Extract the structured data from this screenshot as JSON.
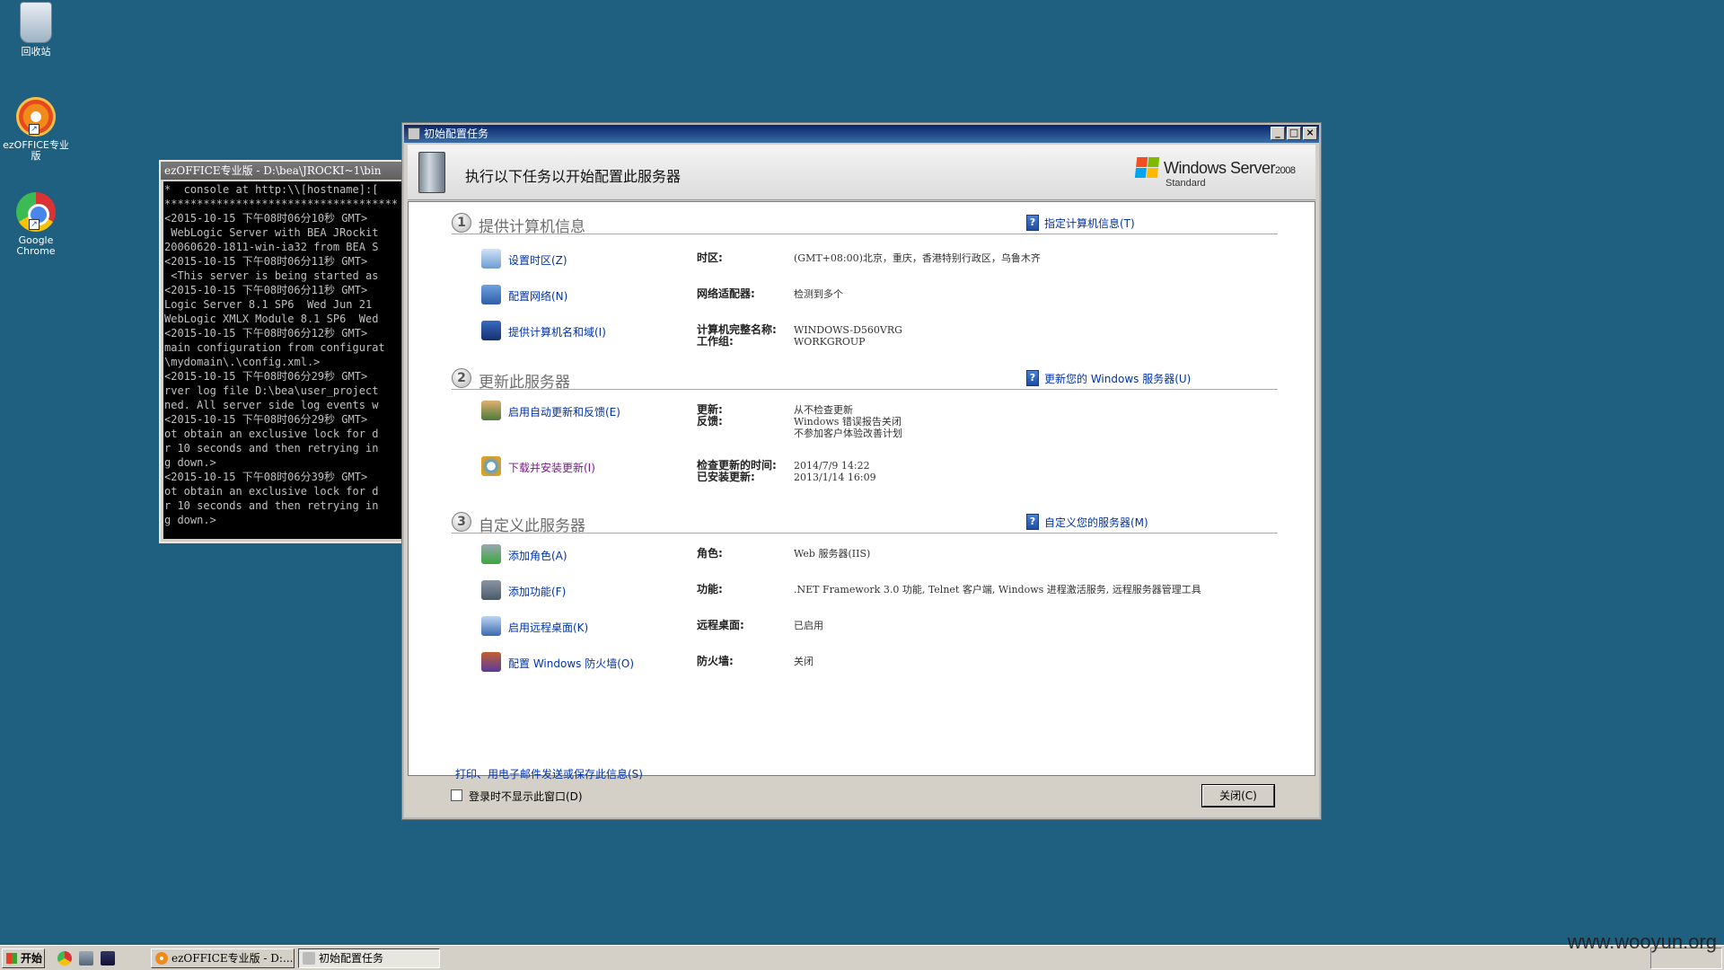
{
  "desktop": {
    "icons": [
      {
        "label": "回收站",
        "icon": "recycle-bin-icon"
      },
      {
        "label": "ezOFFICE专业版",
        "icon": "ezoffice-icon"
      },
      {
        "label": "Google Chrome",
        "icon": "chrome-icon"
      }
    ]
  },
  "console": {
    "title": "ezOFFICE专业版 - D:\\bea\\JROCKI~1\\bin",
    "lines": [
      "*  console at http:\\\\[hostname]:[",
      "************************************",
      "<2015-10-15 下午08时06分10秒 GMT>",
      " WebLogic Server with BEA JRockit",
      "20060620-1811-win-ia32 from BEA S",
      "<2015-10-15 下午08时06分11秒 GMT>",
      " <This server is being started as",
      "<2015-10-15 下午08时06分11秒 GMT>",
      "Logic Server 8.1 SP6  Wed Jun 21 ",
      "WebLogic XMLX Module 8.1 SP6  Wed",
      "<2015-10-15 下午08时06分12秒 GMT>",
      "main configuration from configurat",
      "\\mydomain\\.\\config.xml.>",
      "<2015-10-15 下午08时06分29秒 GMT>",
      "rver log file D:\\bea\\user_project",
      "ned. All server side log events w",
      "<2015-10-15 下午08时06分29秒 GMT>",
      "ot obtain an exclusive lock for d",
      "r 10 seconds and then retrying in",
      "g down.>",
      "<2015-10-15 下午08时06分39秒 GMT>",
      "ot obtain an exclusive lock for d",
      "r 10 seconds and then retrying in",
      "g down.>"
    ]
  },
  "dialog": {
    "title": "初始配置任务",
    "header_text": "执行以下任务以开始配置此服务器",
    "brand": {
      "name": "Windows Server",
      "version": "2008",
      "edition": "Standard"
    },
    "window_buttons": {
      "minimize": "_",
      "maximize": "□",
      "close": "×"
    },
    "sections": [
      {
        "num": "1",
        "title": "提供计算机信息",
        "link": "指定计算机信息(T)",
        "tasks": [
          {
            "link": "设置时区(Z)",
            "icon": "clock-icon",
            "rows": [
              {
                "label": "时区:",
                "values": [
                  "(GMT+08:00)北京，重庆，香港特别行政区，乌鲁木齐"
                ]
              }
            ]
          },
          {
            "link": "配置网络(N)",
            "icon": "network-icon",
            "rows": [
              {
                "label": "网络适配器:",
                "values": [
                  "检测到多个"
                ]
              }
            ]
          },
          {
            "link": "提供计算机名和域(I)",
            "icon": "computer-icon",
            "rows": [
              {
                "label": "计算机完整名称:",
                "values": [
                  "WINDOWS-D560VRG"
                ]
              },
              {
                "label": "工作组:",
                "values": [
                  "WORKGROUP"
                ]
              }
            ]
          }
        ]
      },
      {
        "num": "2",
        "title": "更新此服务器",
        "link": "更新您的 Windows 服务器(U)",
        "tasks": [
          {
            "link": "启用自动更新和反馈(E)",
            "icon": "users-icon",
            "rows": [
              {
                "label": "更新:",
                "values": [
                  "从不检查更新"
                ]
              },
              {
                "label": "反馈:",
                "values": [
                  "Windows 错误报告关闭",
                  "不参加客户体验改善计划"
                ]
              }
            ]
          },
          {
            "link": "下载并安装更新(I)",
            "icon": "update-icon",
            "rows": [
              {
                "label": "检查更新的时间:",
                "values": [
                  "2014/7/9 14:22"
                ]
              },
              {
                "label": "已安装更新:",
                "values": [
                  "2013/1/14 16:09"
                ]
              }
            ]
          }
        ]
      },
      {
        "num": "3",
        "title": "自定义此服务器",
        "link": "自定义您的服务器(M)",
        "tasks": [
          {
            "link": "添加角色(A)",
            "icon": "add-role-icon",
            "rows": [
              {
                "label": "角色:",
                "values": [
                  "Web 服务器(IIS)"
                ]
              }
            ]
          },
          {
            "link": "添加功能(F)",
            "icon": "add-feature-icon",
            "rows": [
              {
                "label": "功能:",
                "values": [
                  ".NET Framework 3.0 功能, Telnet 客户端, Windows 进程激活服务, 远程服务器管理工具"
                ]
              }
            ]
          },
          {
            "link": "启用远程桌面(K)",
            "icon": "remote-desktop-icon",
            "rows": [
              {
                "label": "远程桌面:",
                "values": [
                  "已启用"
                ]
              }
            ]
          },
          {
            "link": "配置 Windows 防火墙(O)",
            "icon": "firewall-icon",
            "rows": [
              {
                "label": "防火墙:",
                "values": [
                  "关闭"
                ]
              }
            ]
          }
        ]
      }
    ],
    "print_link": "打印、用电子邮件发送或保存此信息(S)",
    "footer": {
      "checkbox_label": "登录时不显示此窗口(D)",
      "checkbox_checked": false,
      "close_button": "关闭(C)"
    }
  },
  "taskbar": {
    "start_label": "开始",
    "items": [
      {
        "label": "ezOFFICE专业版 - D:...",
        "active": false
      },
      {
        "label": "初始配置任务",
        "active": true
      }
    ]
  },
  "watermark": "www.wooyun.org"
}
